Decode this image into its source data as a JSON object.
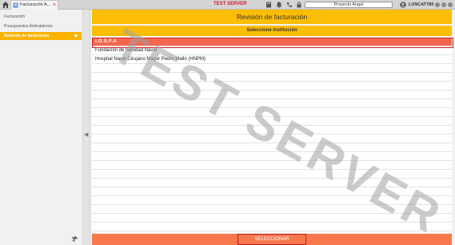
{
  "topbar": {
    "tab_label": "Facturación A...",
    "tab_close": "×",
    "server_label": "TEST SERVER",
    "project_label": "Proyecto Angel",
    "username": "LUNCAT780"
  },
  "sidebar": {
    "items": [
      {
        "label": "Facturación",
        "active": false
      },
      {
        "label": "Presupuestos Ambulatorios",
        "active": false
      },
      {
        "label": "Revisión de facturación",
        "active": true
      }
    ],
    "active_arrow": "▶"
  },
  "collapse": {
    "arrow": "◀"
  },
  "main": {
    "title": "Revisión de facturación",
    "subtitle": "Seleccione Institución",
    "rows": [
      "I.O.S.F.A",
      "Fundación de Sanidad Naval",
      "Hospital Naval Cirujano Mayor Pedro Mallo (HNPM)",
      "",
      "",
      "",
      "",
      "",
      "",
      "",
      "",
      "",
      "",
      "",
      "",
      "",
      "",
      "",
      "",
      "",
      "",
      ""
    ],
    "selected_index": 0,
    "watermark": "TEST SERVER",
    "select_button": "SELECCIONAR"
  },
  "colors": {
    "accent": "#fbbd05",
    "selected_row": "#f5664e",
    "footer": "#f8784e",
    "server_label": "#d6182b"
  },
  "icons": [
    "home-icon",
    "tab-app-icon",
    "book-icon",
    "notification-icon",
    "phone-icon",
    "lock-icon",
    "user-avatar-icon",
    "pin-icon"
  ]
}
